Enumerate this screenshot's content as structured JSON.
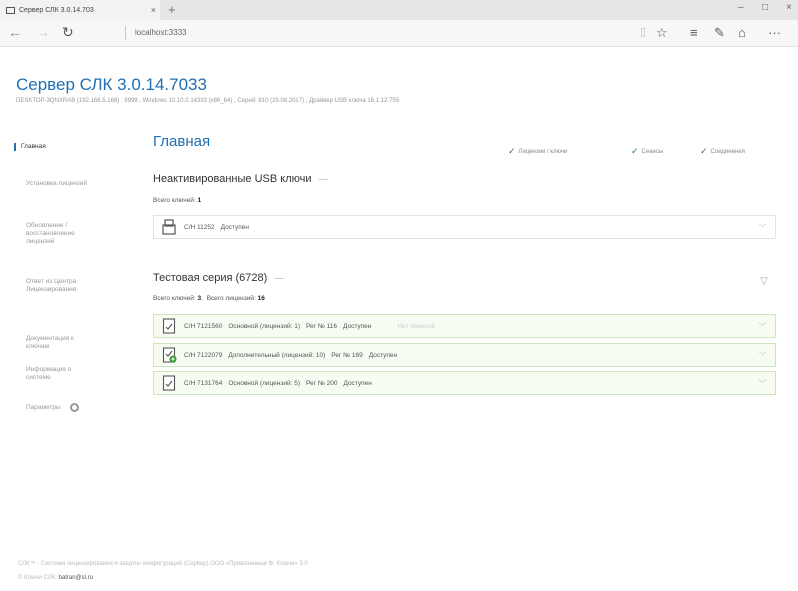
{
  "browser": {
    "tab_title": "Сервер СЛК 3.0.14.703",
    "tab_close": "×",
    "new_tab": "+",
    "address": "localhost:3333",
    "window_controls": [
      "–",
      "□",
      "×"
    ],
    "icons": {
      "back": "back-arrow-icon",
      "forward": "forward-arrow-icon",
      "refresh": "refresh-icon",
      "reading": "reading-view-icon",
      "favorite": "star-icon",
      "hub": "hub-icon",
      "note": "web-note-icon",
      "share": "share-icon",
      "more": "more-icon"
    }
  },
  "app": {
    "title": "Сервер СЛК 3.0.14.7033",
    "subtitle": "DESKTOP-3QNXRAB (192.168.5.168) : 9999 ,  Windows 10.10.0.14393 (x86_64) ,  Серий: 810 (29.08.2017) ,  Драйвер USB ключа 16.1.12.755"
  },
  "sidebar": {
    "items": [
      {
        "label": "Главная",
        "active": true
      },
      {
        "label": "Установка лицензий"
      },
      {
        "label": "Обновление / восстановление лицензий"
      },
      {
        "label": "Ответ из Центра Лицензирования"
      },
      {
        "label": "Документация к ключам"
      },
      {
        "label": "Информация о системе"
      },
      {
        "label": "Параметры"
      }
    ]
  },
  "main": {
    "heading": "Главная",
    "filters": [
      {
        "label": "Лицензии / ключи",
        "checked": true
      },
      {
        "label": "Сеансы",
        "checked": true
      },
      {
        "label": "Соединения",
        "checked": true
      }
    ],
    "groups": [
      {
        "title": "Неактивированные USB ключи",
        "collapse": "—",
        "meta_label": "Всего ключей:",
        "meta_value": "1",
        "rows": [
          {
            "icon": "usb-key-icon",
            "parts": [
              "С/Н 11252",
              "Доступен"
            ]
          }
        ]
      },
      {
        "title": "Тестовая серия (6728)",
        "collapse": "—",
        "meta_label": "Всего ключей:",
        "meta_value": "3",
        "meta_label2": "Всего лицензий:",
        "meta_value2": "16",
        "rows": [
          {
            "icon": "license-file-icon",
            "parts": [
              "С/Н 7121560",
              "Основной (лицензий: 1)",
              "Рег № 116",
              "Доступен"
            ],
            "note": "Нет сеансов"
          },
          {
            "icon": "license-file-add-icon",
            "parts": [
              "С/Н 7122079",
              "Дополнительный (лицензий: 10)",
              "Рег № 169",
              "Доступен"
            ]
          },
          {
            "icon": "license-file-icon",
            "parts": [
              "С/Н 7131764",
              "Основной (лицензий: 5)",
              "Рег № 200",
              "Доступен"
            ]
          }
        ]
      }
    ]
  },
  "footer": {
    "line1": "СЛК™ - Система лицензирования и защиты конфигураций (Сервер) ООО «Привязанные Ф. Ключи» 3.0",
    "line2_prefix": "© Ключи СЛК:",
    "email": "batran@sl.ru"
  },
  "colors": {
    "accent": "#1e6fb5",
    "check": "#2e7d32",
    "row_green": "#f7fcf3"
  }
}
